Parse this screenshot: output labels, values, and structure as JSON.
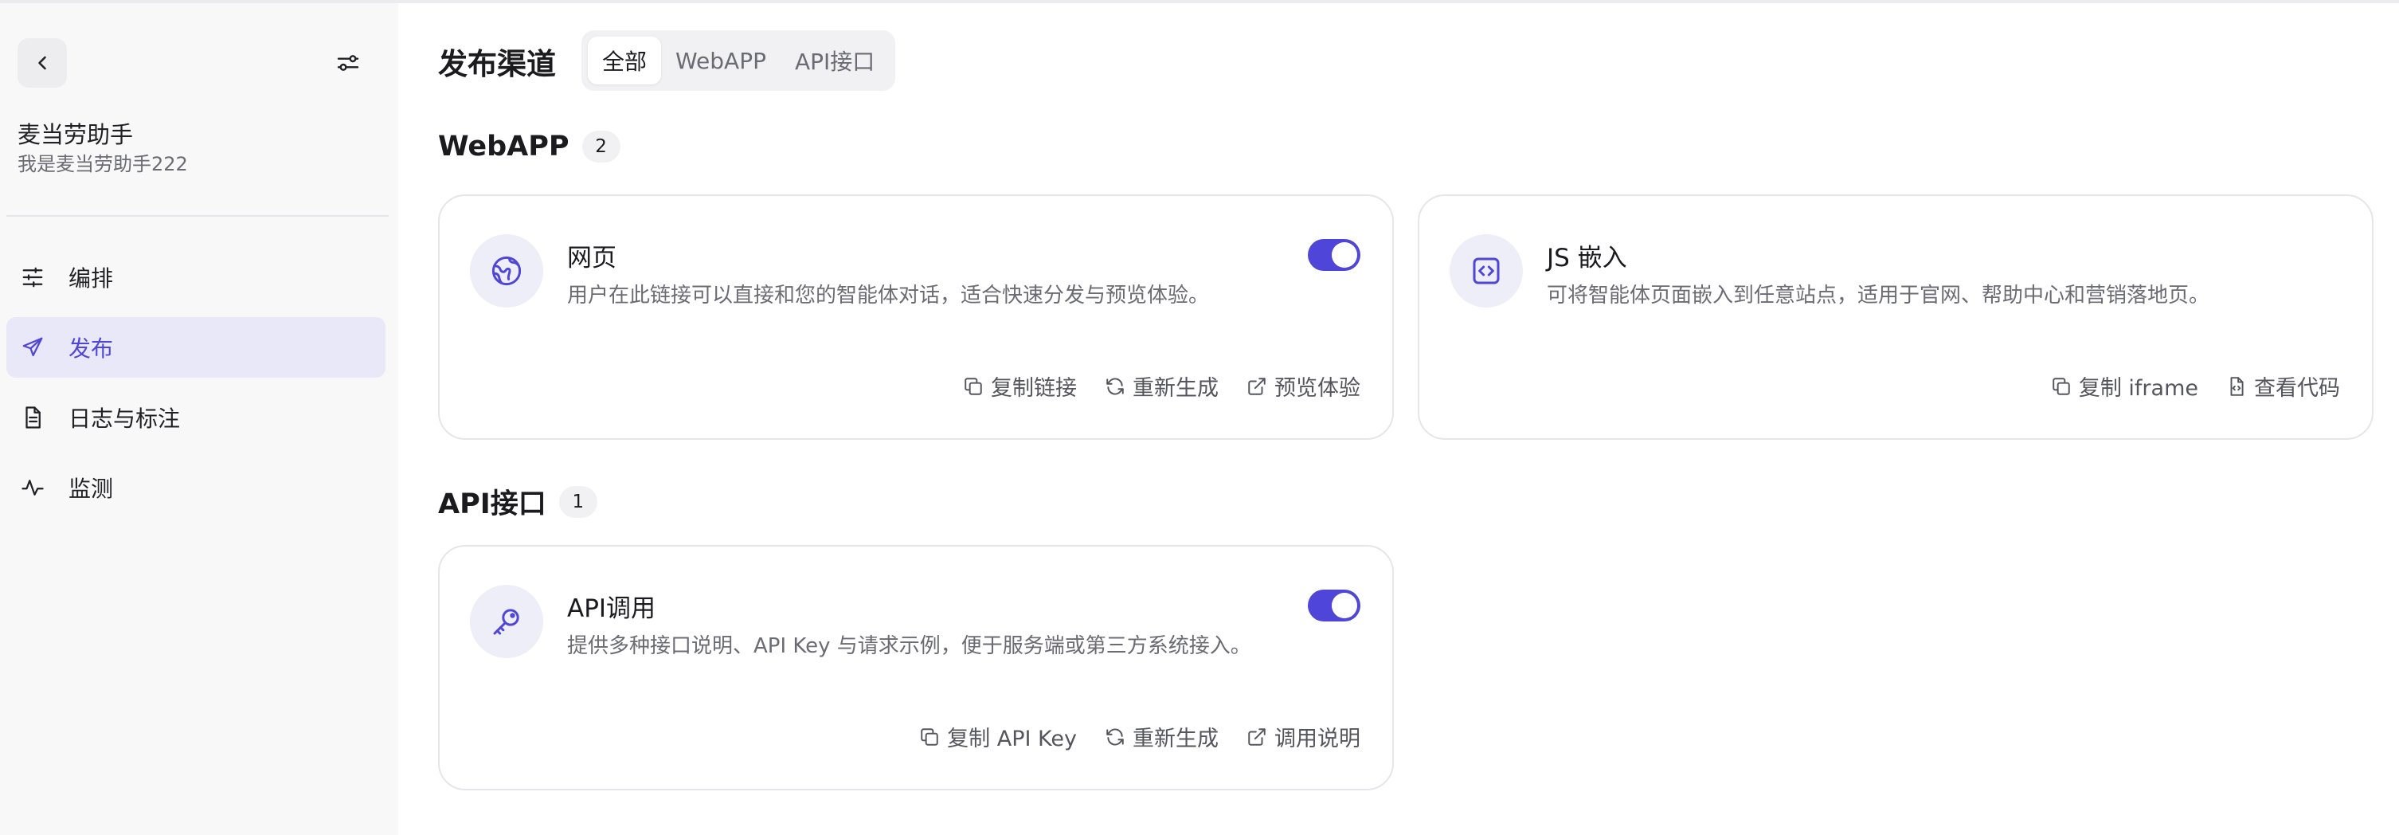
{
  "sidebar": {
    "app_name": "麦当劳助手",
    "app_desc": "我是麦当劳助手222",
    "nav": [
      {
        "label": "编排",
        "icon": "sliders-icon"
      },
      {
        "label": "发布",
        "icon": "send-icon"
      },
      {
        "label": "日志与标注",
        "icon": "document-icon"
      },
      {
        "label": "监测",
        "icon": "activity-icon"
      }
    ],
    "active_nav": "发布"
  },
  "header": {
    "title": "发布渠道",
    "tabs": [
      "全部",
      "WebAPP",
      "API接口"
    ],
    "active_tab": "全部"
  },
  "sections": {
    "webapp": {
      "title": "WebAPP",
      "count": "2",
      "cards": [
        {
          "title": "网页",
          "desc": "用户在此链接可以直接和您的智能体对话，适合快速分发与预览体验。",
          "icon": "globe-icon",
          "enabled": true,
          "actions": [
            "复制链接",
            "重新生成",
            "预览体验"
          ]
        },
        {
          "title": "JS 嵌入",
          "desc": "可将智能体页面嵌入到任意站点，适用于官网、帮助中心和营销落地页。",
          "icon": "code-embed-icon",
          "actions": [
            "复制 iframe",
            "查看代码"
          ]
        }
      ]
    },
    "api": {
      "title": "API接口",
      "count": "1",
      "cards": [
        {
          "title": "API调用",
          "desc": "提供多种接口说明、API Key 与请求示例，便于服务端或第三方系统接入。",
          "icon": "key-icon",
          "enabled": true,
          "actions": [
            "复制 API Key",
            "重新生成",
            "调用说明"
          ]
        }
      ]
    }
  },
  "colors": {
    "accent": "#4f46d9",
    "sidebar_bg": "#f8f8f9",
    "active_nav_bg": "#e9e8f8",
    "muted_text": "#6b6b74"
  }
}
